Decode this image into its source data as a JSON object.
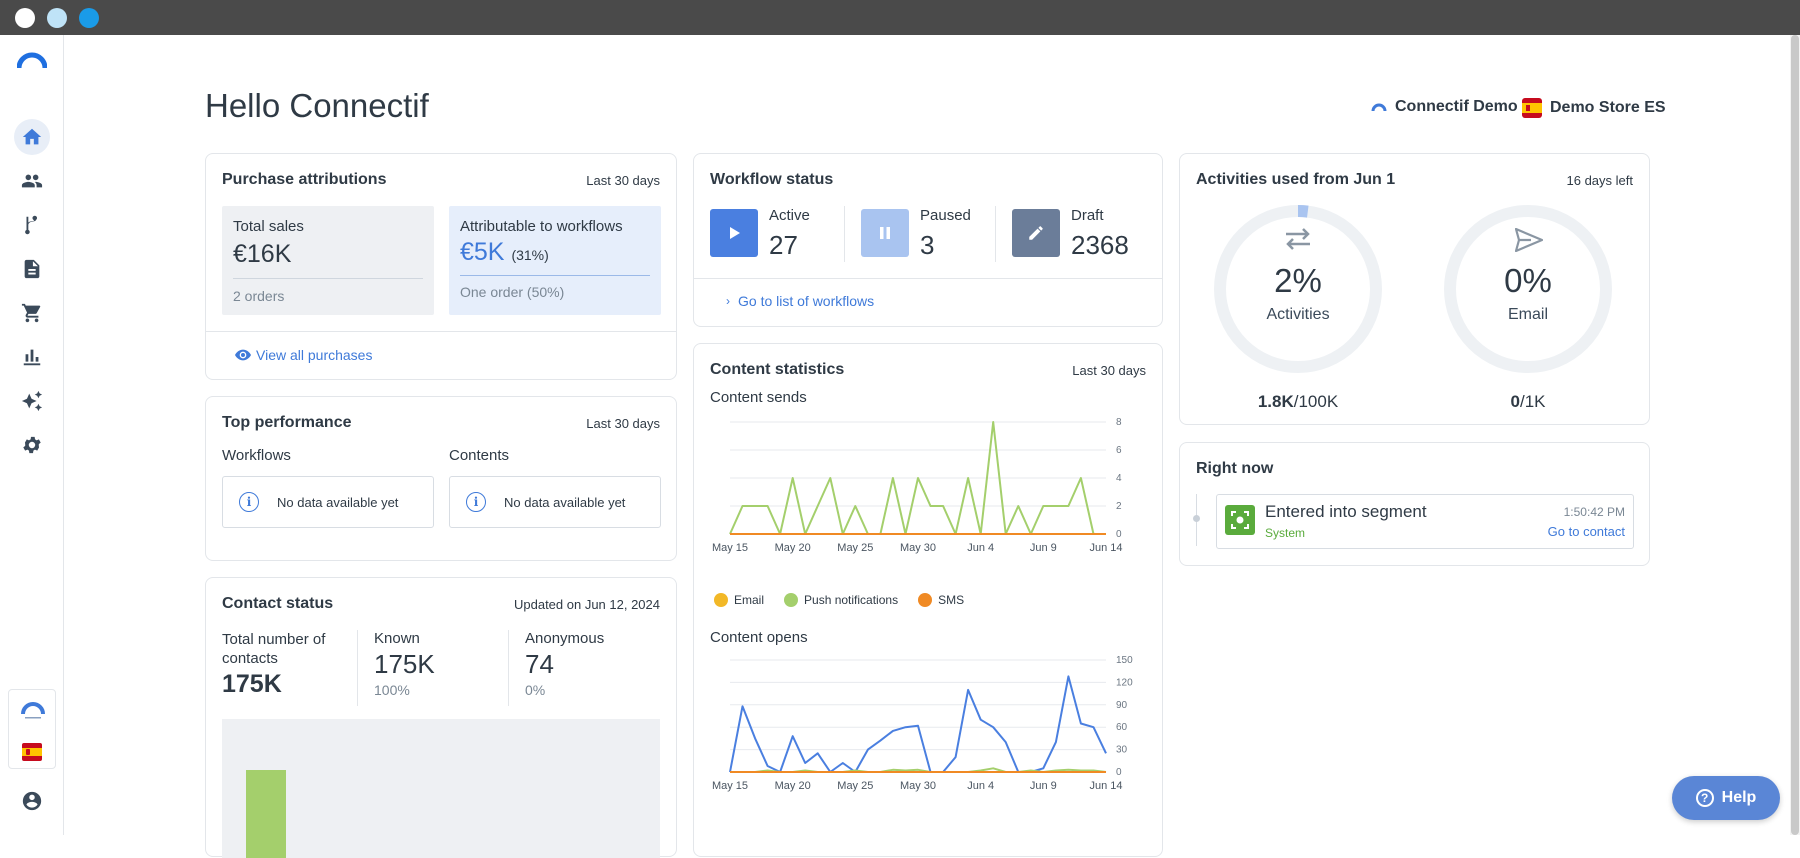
{
  "header": {
    "greeting": "Hello Connectif",
    "account_name": "Connectif Demo",
    "store_name": "Demo Store ES"
  },
  "sidebar": {
    "items": [
      {
        "icon": "home-icon",
        "active": true
      },
      {
        "icon": "contacts-icon",
        "active": false
      },
      {
        "icon": "workflow-icon",
        "active": false
      },
      {
        "icon": "content-icon",
        "active": false
      },
      {
        "icon": "cart-icon",
        "active": false
      },
      {
        "icon": "reports-icon",
        "active": false
      },
      {
        "icon": "sparkle-icon",
        "active": false
      },
      {
        "icon": "gear-icon",
        "active": false
      }
    ]
  },
  "purchase_attributions": {
    "title": "Purchase attributions",
    "period": "Last 30 days",
    "total_sales_label": "Total sales",
    "total_sales_value": "€16K",
    "total_sales_orders": "2 orders",
    "attributable_label": "Attributable to workflows",
    "attributable_value": "€5K",
    "attributable_pct": "(31%)",
    "attributable_orders": "One order (50%)",
    "view_all": "View all purchases"
  },
  "top_performance": {
    "title": "Top performance",
    "period": "Last 30 days",
    "workflows_label": "Workflows",
    "contents_label": "Contents",
    "workflows_empty": "No data available yet",
    "contents_empty": "No data available yet"
  },
  "contact_status": {
    "title": "Contact status",
    "updated": "Updated on Jun 12, 2024",
    "total_label": "Total number of contacts",
    "total_value": "175K",
    "known_label": "Known",
    "known_value": "175K",
    "known_pct": "100%",
    "anonymous_label": "Anonymous",
    "anonymous_value": "74",
    "anonymous_pct": "0%",
    "known_fraction": 1.0
  },
  "workflow_status": {
    "title": "Workflow status",
    "active_label": "Active",
    "active_value": "27",
    "paused_label": "Paused",
    "paused_value": "3",
    "draft_label": "Draft",
    "draft_value": "2368",
    "go_to_list": "Go to list of workflows",
    "colors": {
      "active": "#4a7fe0",
      "paused": "#a9c4f0",
      "draft": "#6b7d99"
    }
  },
  "content_statistics": {
    "title": "Content statistics",
    "period": "Last 30 days",
    "sends_title": "Content sends",
    "opens_title": "Content opens",
    "legend": [
      {
        "name": "Email",
        "color": "#f2b827"
      },
      {
        "name": "Push notifications",
        "color": "#a4cf6c"
      },
      {
        "name": "SMS",
        "color": "#f08a24"
      }
    ]
  },
  "chart_data": [
    {
      "type": "line",
      "title": "Content sends",
      "x_ticks": [
        "May 15",
        "May 20",
        "May 25",
        "May 30",
        "Jun 4",
        "Jun 9",
        "Jun 14"
      ],
      "y_ticks": [
        0,
        2,
        4,
        6,
        8
      ],
      "ylim": [
        0,
        8
      ],
      "x_days": 31,
      "series": [
        {
          "name": "Email",
          "color": "#f2b827",
          "values": [
            0,
            0,
            0,
            0,
            0,
            0,
            0,
            0,
            0,
            0,
            0,
            0,
            0,
            0,
            0,
            0,
            0,
            0,
            0,
            0,
            0,
            0,
            0,
            0,
            0,
            0,
            0,
            0,
            0,
            0,
            0
          ]
        },
        {
          "name": "Push notifications",
          "color": "#a4cf6c",
          "values": [
            0,
            2,
            2,
            2,
            0,
            4,
            0,
            2,
            4,
            0,
            2,
            0,
            0,
            4,
            0,
            4,
            2,
            2,
            0,
            4,
            0,
            8,
            0,
            2,
            0,
            2,
            2,
            2,
            4,
            0,
            0
          ]
        },
        {
          "name": "SMS",
          "color": "#f08a24",
          "values": [
            0,
            0,
            0,
            0,
            0,
            0,
            0,
            0,
            0,
            0,
            0,
            0,
            0,
            0,
            0,
            0,
            0,
            0,
            0,
            0,
            0,
            0,
            0,
            0,
            0,
            0,
            0,
            0,
            0,
            0,
            0
          ]
        }
      ]
    },
    {
      "type": "line",
      "title": "Content opens",
      "x_ticks": [
        "May 15",
        "May 20",
        "May 25",
        "May 30",
        "Jun 4",
        "Jun 9",
        "Jun 14"
      ],
      "y_ticks": [
        0,
        30,
        60,
        90,
        120,
        150
      ],
      "ylim": [
        0,
        150
      ],
      "x_days": 31,
      "series": [
        {
          "name": "Email",
          "color": "#4a7fe0",
          "values": [
            0,
            88,
            45,
            8,
            0,
            48,
            12,
            25,
            0,
            12,
            0,
            30,
            42,
            55,
            60,
            62,
            0,
            0,
            20,
            110,
            70,
            60,
            40,
            0,
            0,
            5,
            40,
            128,
            65,
            60,
            25
          ]
        },
        {
          "name": "Push notifications",
          "color": "#a4cf6c",
          "values": [
            0,
            0,
            0,
            2,
            0,
            0,
            2,
            0,
            0,
            0,
            2,
            0,
            0,
            3,
            2,
            3,
            0,
            0,
            0,
            0,
            2,
            5,
            0,
            0,
            2,
            0,
            2,
            3,
            2,
            2,
            0
          ]
        },
        {
          "name": "SMS",
          "color": "#f08a24",
          "values": [
            0,
            0,
            0,
            0,
            0,
            0,
            0,
            0,
            0,
            0,
            0,
            0,
            0,
            0,
            0,
            0,
            0,
            0,
            0,
            0,
            0,
            0,
            0,
            0,
            0,
            0,
            0,
            0,
            0,
            0,
            0
          ]
        }
      ]
    }
  ],
  "activities": {
    "title": "Activities used from Jun 1",
    "remaining": "16 days left",
    "activities_pct": "2%",
    "activities_label": "Activities",
    "activities_used": "1.8K",
    "activities_limit": "/100K",
    "activities_fraction": 0.02,
    "email_pct": "0%",
    "email_label": "Email",
    "email_used": "0",
    "email_limit": "/1K",
    "email_fraction": 0.0
  },
  "right_now": {
    "title": "Right now",
    "event_title": "Entered into segment",
    "event_source": "System",
    "event_time": "1:50:42 PM",
    "event_link": "Go to contact"
  },
  "help": {
    "label": "Help"
  }
}
